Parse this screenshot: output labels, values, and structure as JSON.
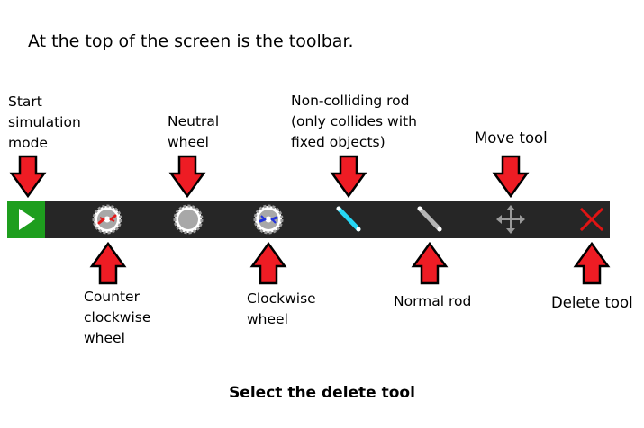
{
  "intro_text": "At the top of the screen is the toolbar.",
  "caption": "Select the delete tool",
  "labels": {
    "start": [
      "Start",
      "simulation",
      "mode"
    ],
    "neutral": [
      "Neutral",
      "wheel"
    ],
    "noncolliding": [
      "Non-colliding rod",
      "(only collides with",
      "fixed objects)"
    ],
    "move": [
      "Move tool"
    ],
    "ccw": [
      "Counter",
      "clockwise",
      "wheel"
    ],
    "cw": [
      "Clockwise",
      "wheel"
    ],
    "normal": [
      "Normal rod"
    ],
    "delete": [
      "Delete tool"
    ]
  },
  "toolbar": {
    "tools": [
      {
        "name": "start-simulation",
        "icon": "play-icon"
      },
      {
        "name": "counter-clockwise-wheel",
        "icon": "ccw-wheel-icon"
      },
      {
        "name": "neutral-wheel",
        "icon": "neutral-wheel-icon"
      },
      {
        "name": "clockwise-wheel",
        "icon": "cw-wheel-icon"
      },
      {
        "name": "non-colliding-rod",
        "icon": "cyan-rod-icon"
      },
      {
        "name": "normal-rod",
        "icon": "gray-rod-icon"
      },
      {
        "name": "move-tool",
        "icon": "move-arrows-icon"
      },
      {
        "name": "delete-tool",
        "icon": "red-x-icon"
      }
    ]
  },
  "colors": {
    "toolbar_bg": "#262626",
    "play_bg": "#1e9e1e",
    "arrow_fill": "#ee1c24",
    "ccw_accent": "#e21b1b",
    "cw_accent": "#2233dd",
    "cyan_rod": "#26d7f5",
    "delete_x": "#e01414"
  }
}
